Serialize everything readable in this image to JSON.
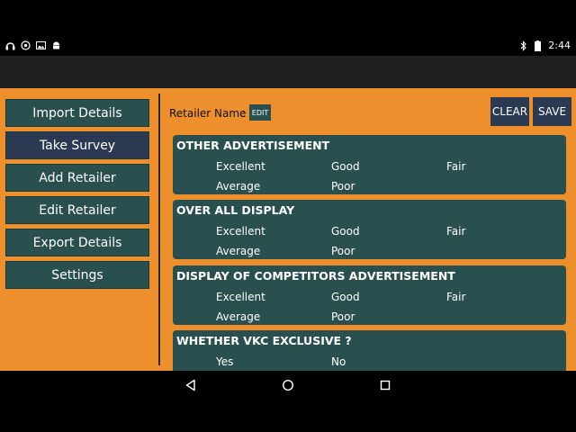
{
  "status_bar": {
    "time": "2:44",
    "left_icons": [
      "headphones-icon",
      "whatsapp-icon",
      "image-icon",
      "android-icon"
    ],
    "right_icons": [
      "bluetooth-icon",
      "battery-icon"
    ]
  },
  "sidebar": {
    "items": [
      {
        "label": "Import Details",
        "active": false
      },
      {
        "label": "Take Survey",
        "active": true
      },
      {
        "label": "Add Retailer",
        "active": false
      },
      {
        "label": "Edit Retailer",
        "active": false
      },
      {
        "label": "Export Details",
        "active": false
      },
      {
        "label": "Settings",
        "active": false
      }
    ]
  },
  "header": {
    "retailer_label": "Retailer Name",
    "colon": ":",
    "edit_label": "EDIT",
    "clear_label": "CLEAR",
    "save_label": "SAVE"
  },
  "questions": [
    {
      "title": "OTHER ADVERTISEMENT",
      "options": [
        "Excellent",
        "Good",
        "Fair",
        "Average",
        "Poor"
      ]
    },
    {
      "title": "OVER ALL DISPLAY",
      "options": [
        "Excellent",
        "Good",
        "Fair",
        "Average",
        "Poor"
      ]
    },
    {
      "title": "DISPLAY OF COMPETITORS ADVERTISEMENT",
      "options": [
        "Excellent",
        "Good",
        "Fair",
        "Average",
        "Poor"
      ]
    },
    {
      "title": "WHETHER VKC EXCLUSIVE ?",
      "options": [
        "Yes",
        "No"
      ]
    }
  ],
  "colors": {
    "background": "#ec8f2c",
    "card": "#2a4f4f",
    "active_button": "#2b3a52"
  }
}
